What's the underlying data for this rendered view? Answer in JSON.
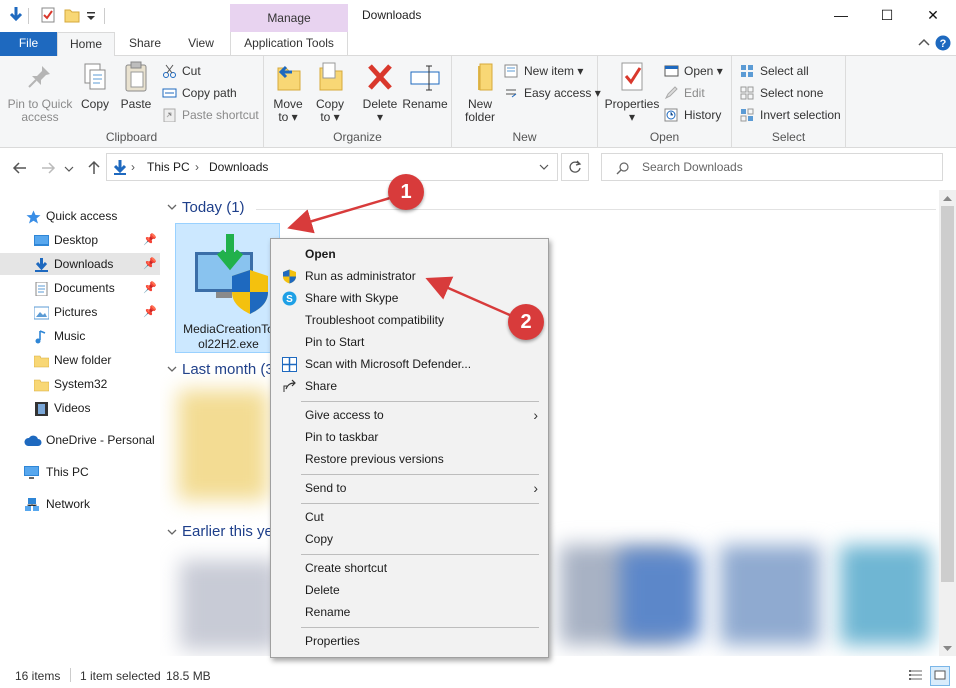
{
  "window": {
    "title": "Downloads",
    "manage_tab": "Manage",
    "controls": {
      "minimize": "—",
      "maximize": "☐",
      "close": "✕"
    }
  },
  "ribbon_tabs": {
    "file": "File",
    "home": "Home",
    "share": "Share",
    "view": "View",
    "application_tools": "Application Tools"
  },
  "ribbon": {
    "clipboard": {
      "label": "Clipboard",
      "pin_to_quick_access": [
        "Pin to Quick",
        "access"
      ],
      "copy": "Copy",
      "paste": "Paste",
      "cut": "Cut",
      "copy_path": "Copy path",
      "paste_shortcut": "Paste shortcut"
    },
    "organize": {
      "label": "Organize",
      "move_to": [
        "Move",
        "to ▾"
      ],
      "copy_to": [
        "Copy",
        "to ▾"
      ],
      "delete": [
        "Delete",
        "▾"
      ],
      "rename": "Rename"
    },
    "new": {
      "label": "New",
      "new_folder": [
        "New",
        "folder"
      ],
      "new_item": "New item ▾",
      "easy_access": "Easy access ▾"
    },
    "open": {
      "label": "Open",
      "properties": [
        "Properties",
        "▾"
      ],
      "open": "Open ▾",
      "edit": "Edit",
      "history": "History"
    },
    "select": {
      "label": "Select",
      "select_all": "Select all",
      "select_none": "Select none",
      "invert_selection": "Invert selection"
    }
  },
  "address": {
    "path": [
      "This PC",
      "Downloads"
    ],
    "search_placeholder": "Search Downloads"
  },
  "sidebar": {
    "items": [
      {
        "label": "Quick access",
        "icon": "star-icon",
        "pinned": false,
        "selected": false
      },
      {
        "label": "Desktop",
        "icon": "desktop-icon",
        "pinned": true,
        "selected": false
      },
      {
        "label": "Downloads",
        "icon": "download-arrow-icon",
        "pinned": true,
        "selected": true
      },
      {
        "label": "Documents",
        "icon": "document-icon",
        "pinned": true,
        "selected": false
      },
      {
        "label": "Pictures",
        "icon": "pictures-icon",
        "pinned": true,
        "selected": false
      },
      {
        "label": "Music",
        "icon": "music-note-icon",
        "pinned": false,
        "selected": false
      },
      {
        "label": "New folder",
        "icon": "folder-icon",
        "pinned": false,
        "selected": false
      },
      {
        "label": "System32",
        "icon": "folder-icon",
        "pinned": false,
        "selected": false
      },
      {
        "label": "Videos",
        "icon": "film-icon",
        "pinned": false,
        "selected": false
      },
      {
        "label": "OneDrive - Personal",
        "icon": "cloud-icon",
        "pinned": false,
        "selected": false
      },
      {
        "label": "This PC",
        "icon": "computer-icon",
        "pinned": false,
        "selected": false
      },
      {
        "label": "Network",
        "icon": "network-icon",
        "pinned": false,
        "selected": false
      }
    ]
  },
  "content": {
    "groups": [
      {
        "header": "Today (1)"
      },
      {
        "header": "Last month (3"
      },
      {
        "header": "Earlier this ye"
      }
    ],
    "selected_file": {
      "name_line1": "MediaCreationTo",
      "name_line2": "ol22H2.exe"
    }
  },
  "context_menu": {
    "items": [
      {
        "label": "Open",
        "bold": true,
        "icon": ""
      },
      {
        "label": "Run as administrator",
        "icon": "uac-shield-icon"
      },
      {
        "label": "Share with Skype",
        "icon": "skype-icon"
      },
      {
        "label": "Troubleshoot compatibility",
        "icon": ""
      },
      {
        "label": "Pin to Start",
        "icon": ""
      },
      {
        "label": "Scan with Microsoft Defender...",
        "icon": "defender-icon"
      },
      {
        "label": "Share",
        "icon": "share-icon"
      },
      {
        "label": "Give access to",
        "submenu": true
      },
      {
        "label": "Pin to taskbar"
      },
      {
        "label": "Restore previous versions"
      },
      {
        "label": "Send to",
        "submenu": true
      },
      {
        "label": "Cut"
      },
      {
        "label": "Copy"
      },
      {
        "label": "Create shortcut"
      },
      {
        "label": "Delete"
      },
      {
        "label": "Rename"
      },
      {
        "label": "Properties"
      }
    ]
  },
  "annotations": {
    "badge1": "1",
    "badge2": "2"
  },
  "status": {
    "item_count": "16 items",
    "selection": "1 item selected",
    "size": "18.5 MB"
  },
  "colors": {
    "accent": "#1e69bf",
    "manage_tab": "#e8d3f0",
    "selection": "#cce8ff",
    "callout": "#d83b3b"
  }
}
